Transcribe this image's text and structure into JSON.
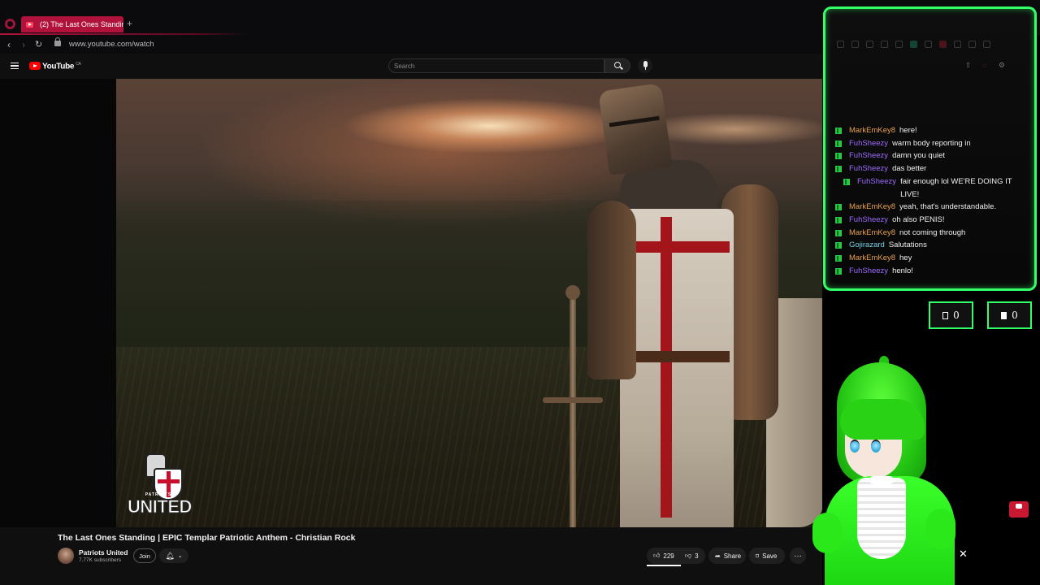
{
  "browser": {
    "tab_title": "(2) The Last Ones Standin",
    "new_tab": "+",
    "url": "www.youtube.com/watch"
  },
  "youtube": {
    "logo": "YouTube",
    "logo_region": "CA",
    "search_placeholder": "Search"
  },
  "video": {
    "title": "The Last Ones Standing | EPIC Templar Patriotic Anthem - Christian Rock",
    "watermark_small": "PATRIOTS",
    "watermark_big": "UNITED"
  },
  "channel": {
    "name": "Patriots United",
    "subscribers": "7.77K subscribers",
    "join_label": "Join"
  },
  "actions": {
    "likes": "229",
    "dislikes": "3",
    "share": "Share",
    "save": "Save",
    "more": "···"
  },
  "chat": {
    "messages": [
      {
        "user": "MarkEmKey8",
        "user_color": "#e8a050",
        "text": "here!"
      },
      {
        "user": "FuhSheezy",
        "user_color": "#9d6bff",
        "text": "warm body reporting in"
      },
      {
        "user": "FuhSheezy",
        "user_color": "#9d6bff",
        "text": "damn you quiet"
      },
      {
        "user": "FuhSheezy",
        "user_color": "#9d6bff",
        "text": "das better"
      },
      {
        "user": "FuhSheezy",
        "user_color": "#9d6bff",
        "text": "fair enough lol WE'RE DOING IT LIVE!"
      },
      {
        "user": "MarkEmKey8",
        "user_color": "#e8a050",
        "text": "yeah, that's understandable."
      },
      {
        "user": "FuhSheezy",
        "user_color": "#9d6bff",
        "text": "oh also PENIS!"
      },
      {
        "user": "MarkEmKey8",
        "user_color": "#e8a050",
        "text": "not coming through"
      },
      {
        "user": "Gojirazard",
        "user_color": "#7ad0e8",
        "text": "Salutations"
      },
      {
        "user": "MarkEmKey8",
        "user_color": "#e8a050",
        "text": "hey"
      },
      {
        "user": "FuhSheezy",
        "user_color": "#9d6bff",
        "text": "henlo!"
      }
    ]
  },
  "counters": {
    "left": "0",
    "right": "0"
  },
  "colors": {
    "accent_green": "#33ff66",
    "tab_red": "#b0123c",
    "yt_red": "#ff0000"
  },
  "icons": [
    "back-icon",
    "forward-icon",
    "reload-icon",
    "lock-icon",
    "menu-icon",
    "search-icon",
    "mic-icon",
    "bell-icon",
    "chevron-down-icon",
    "like-icon",
    "dislike-icon",
    "share-icon",
    "save-icon",
    "more-icon",
    "close-icon",
    "subscribe-icon"
  ]
}
